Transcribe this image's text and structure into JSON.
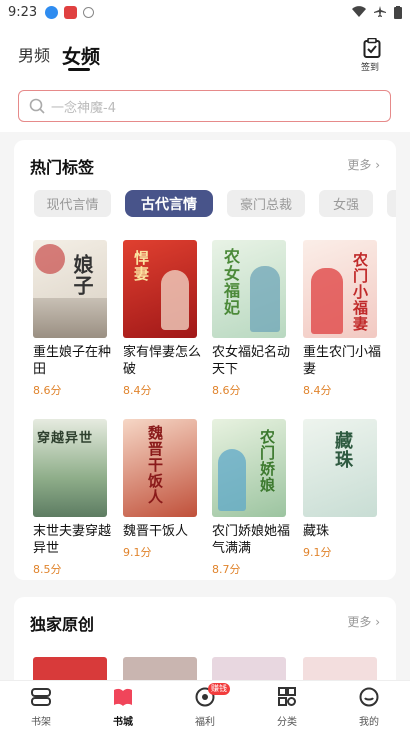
{
  "status_bar": {
    "time": "9:23"
  },
  "header": {
    "tab_male": "男频",
    "tab_female": "女频",
    "checkin_label": "签到"
  },
  "search": {
    "placeholder": "一念神魔-4"
  },
  "hot_tags": {
    "title": "热门标签",
    "more": "更多",
    "chips": [
      "现代言情",
      "古代言情",
      "豪门总裁",
      "女强"
    ],
    "books": [
      {
        "title": "重生娘子在种田",
        "score": "8.6分",
        "cover_text": "娘子"
      },
      {
        "title": "家有悍妻怎么破",
        "score": "8.4分",
        "cover_text": "悍妻"
      },
      {
        "title": "农女福妃名动天下",
        "score": "8.6分",
        "cover_text": "农女福妃"
      },
      {
        "title": "重生农门小福妻",
        "score": "8.4分",
        "cover_text": "农门小福妻"
      },
      {
        "title": "末世夫妻穿越异世",
        "score": "8.5分",
        "cover_text": "穿越异世"
      },
      {
        "title": "魏晋干饭人",
        "score": "9.1分",
        "cover_text": "魏晋干饭人"
      },
      {
        "title": "农门娇娘她福气满满",
        "score": "8.7分",
        "cover_text": "农门娇娘"
      },
      {
        "title": "藏珠",
        "score": "9.1分",
        "cover_text": "藏珠"
      }
    ]
  },
  "exclusive": {
    "title": "独家原创",
    "more": "更多"
  },
  "bottom_nav": [
    {
      "label": "书架"
    },
    {
      "label": "书城"
    },
    {
      "label": "福利",
      "badge": "赚钱"
    },
    {
      "label": "分类"
    },
    {
      "label": "我的"
    }
  ],
  "colors": {
    "accent": "#48548a",
    "score": "#e0842d",
    "search_border": "#e68a8a"
  }
}
